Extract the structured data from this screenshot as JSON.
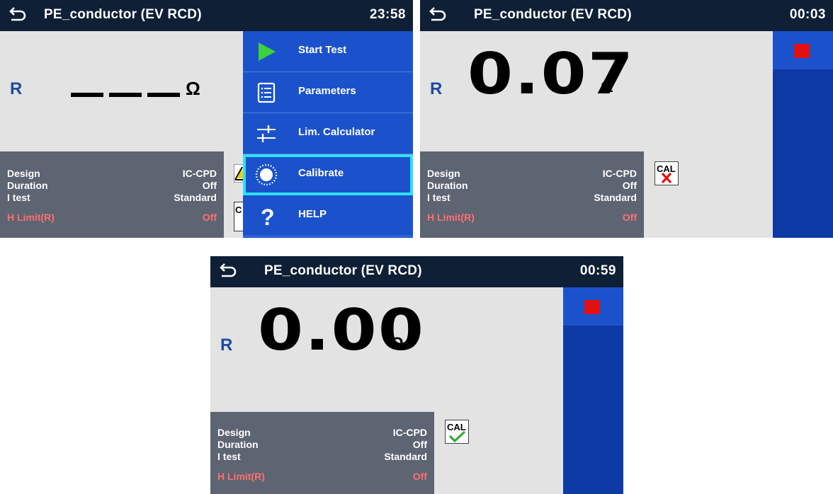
{
  "colors": {
    "titlebar": "#0e1f36",
    "screen_bg": "#e3e3e3",
    "params_bg": "#5d6472",
    "menu_bg": "#1b52cc",
    "sidebar_bg": "#0e3aa5",
    "selected_outline": "#2fe0f5",
    "limit_red": "#ff6f6f",
    "stop_red": "#e21111",
    "r_blue": "#1f4aa0"
  },
  "screens": [
    {
      "title": "PE_conductor (EV RCD)",
      "time": "23:58",
      "result_label": "R",
      "result_value": "___",
      "unit": "Ω",
      "params": [
        {
          "key": "Design",
          "value": "IC-CPD"
        },
        {
          "key": "Duration",
          "value": "Off"
        },
        {
          "key": "I test",
          "value": "Standard"
        },
        {
          "key": "H Limit(R)",
          "value": "Off"
        }
      ],
      "partial_cal_text": "C",
      "menu": [
        {
          "label": "Start Test",
          "icon": "play-icon"
        },
        {
          "label": "Parameters",
          "icon": "list-icon"
        },
        {
          "label": "Lim. Calculator",
          "icon": "sliders-icon"
        },
        {
          "label": "Calibrate",
          "icon": "calibrate-icon",
          "selected": true
        },
        {
          "label": "HELP",
          "icon": "help-icon"
        }
      ]
    },
    {
      "title": "PE_conductor (EV RCD)",
      "time": "00:03",
      "result_label": "R",
      "result_value": "0.07",
      "unit": "Ω",
      "params": [
        {
          "key": "Design",
          "value": "IC-CPD"
        },
        {
          "key": "Duration",
          "value": "Off"
        },
        {
          "key": "I test",
          "value": "Standard"
        },
        {
          "key": "H Limit(R)",
          "value": "Off"
        }
      ],
      "cal_text": "CAL",
      "cal_status": "not-calibrated"
    },
    {
      "title": "PE_conductor (EV RCD)",
      "time": "00:59",
      "result_label": "R",
      "result_value": "0.00",
      "unit": "Ω",
      "params": [
        {
          "key": "Design",
          "value": "IC-CPD"
        },
        {
          "key": "Duration",
          "value": "Off"
        },
        {
          "key": "I test",
          "value": "Standard"
        },
        {
          "key": "H Limit(R)",
          "value": "Off"
        }
      ],
      "cal_text": "CAL",
      "cal_status": "calibrated"
    }
  ]
}
